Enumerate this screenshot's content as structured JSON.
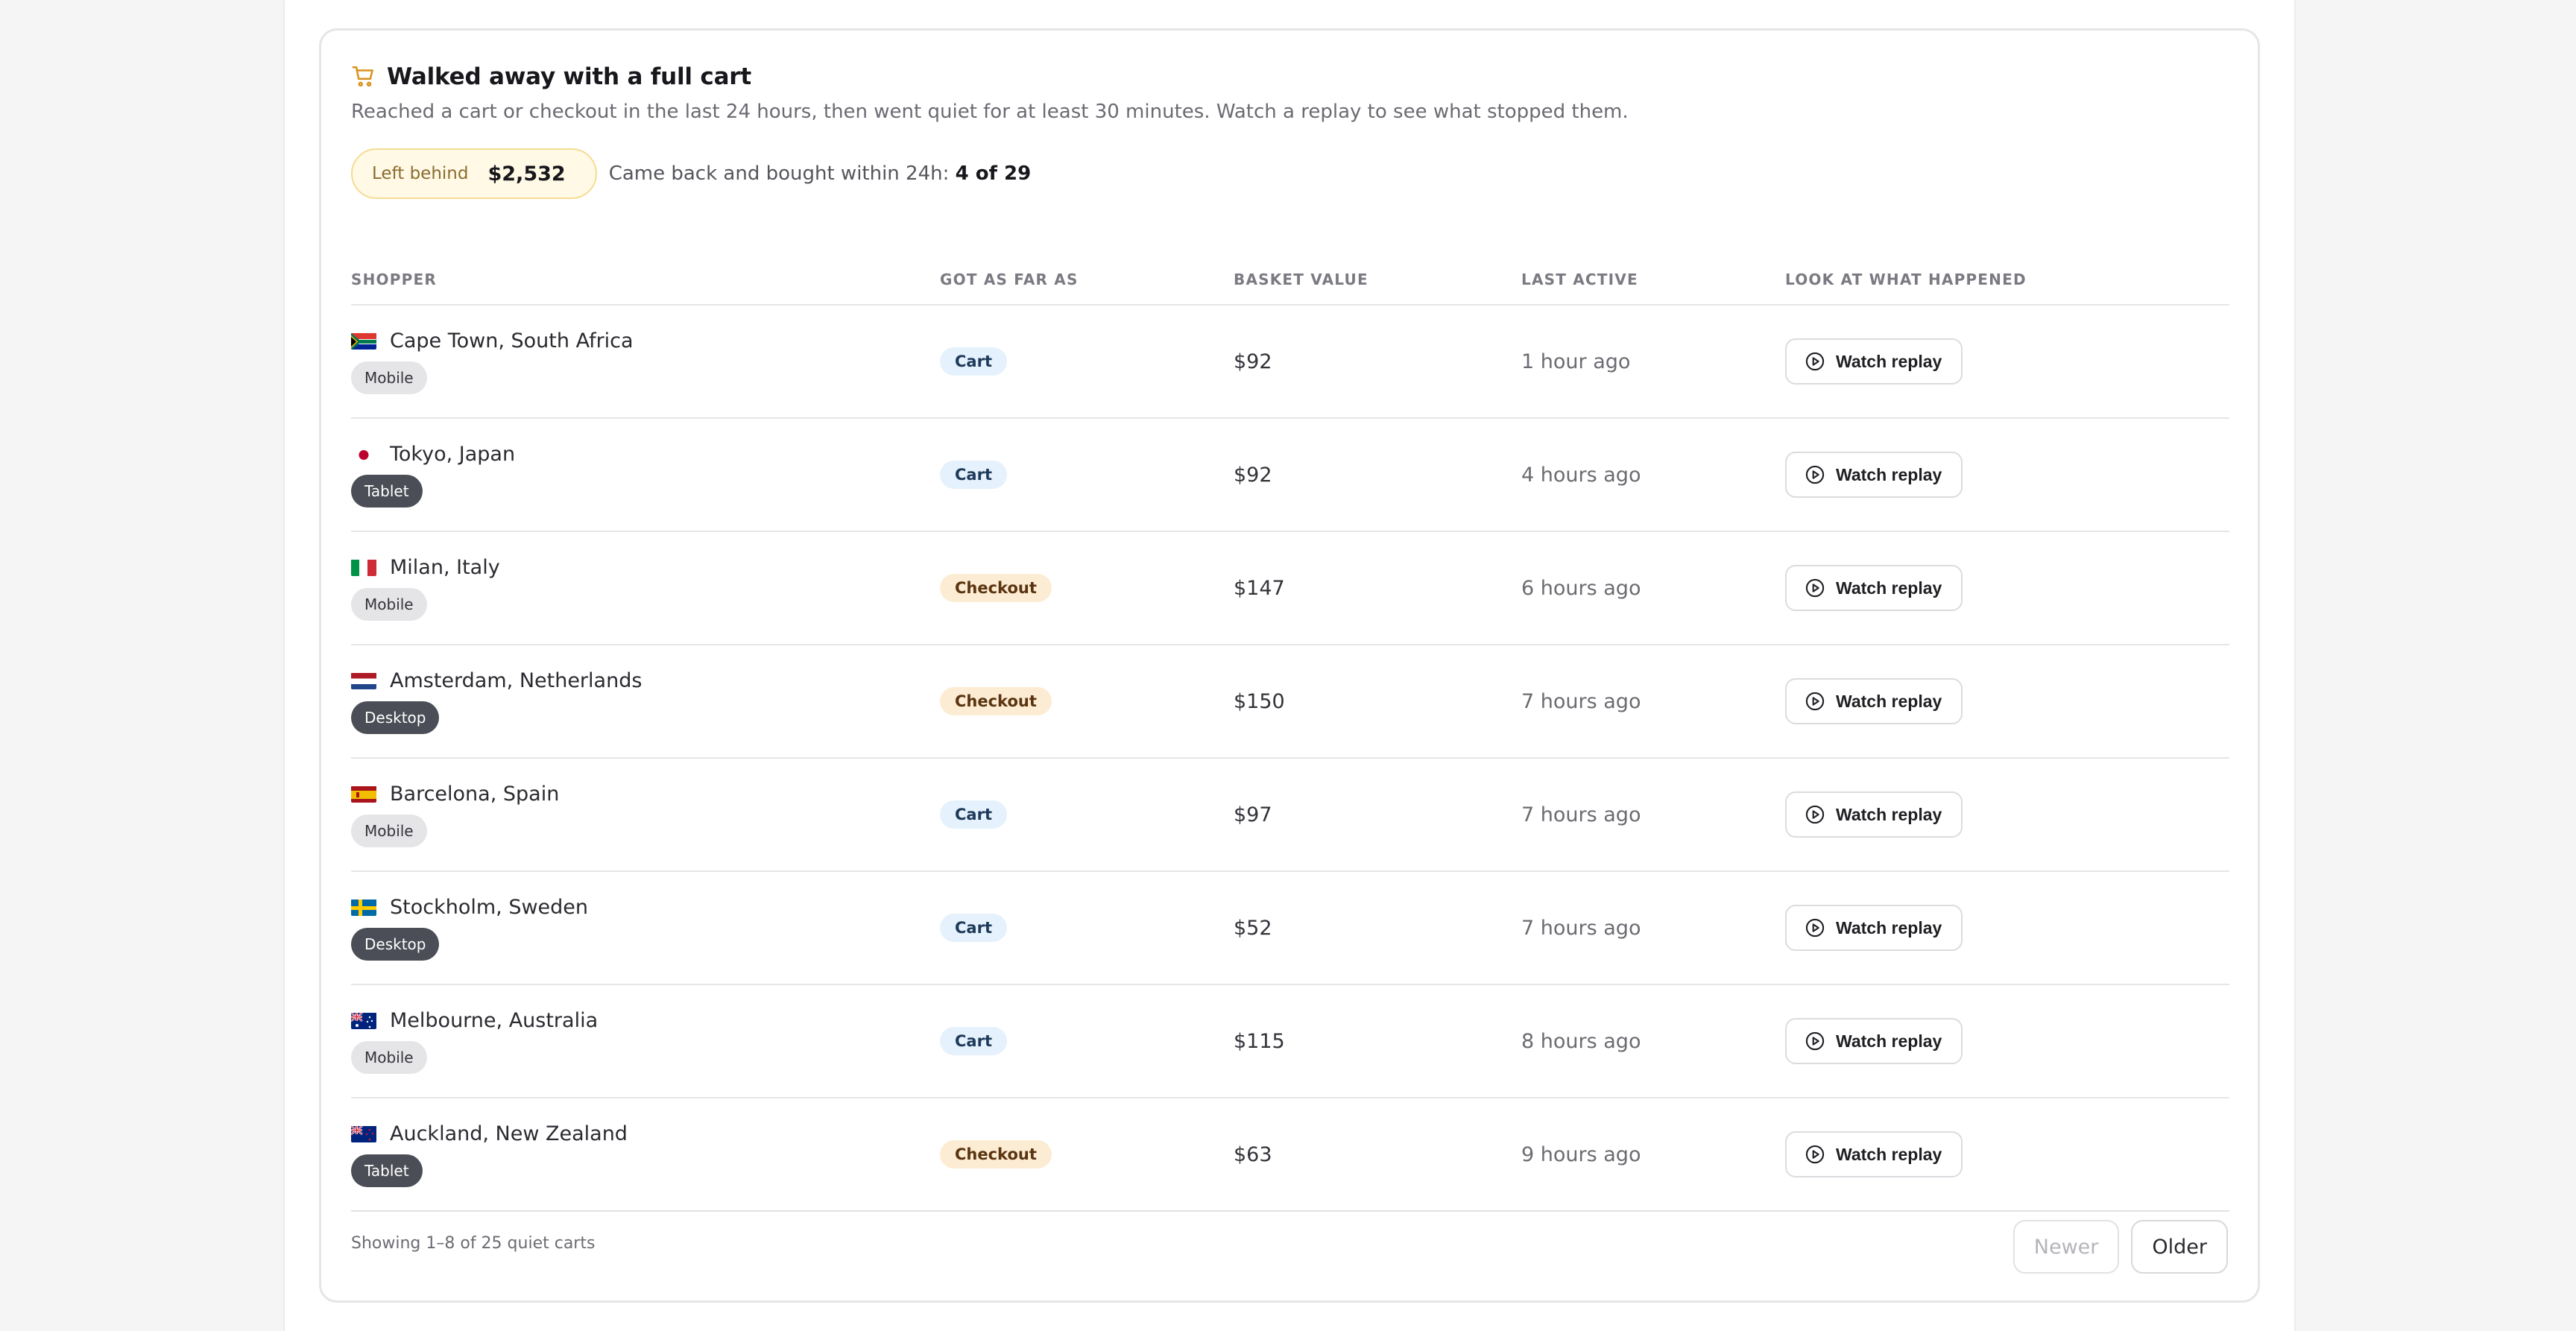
{
  "panel": {
    "title": "Walked away with a full cart",
    "icon": "shopping-cart-icon",
    "subtitle": "Reached a cart or checkout in the last 24 hours, then went quiet for at least 30 minutes. Watch a replay to see what stopped them.",
    "left_behind_label": "Left behind",
    "left_behind_amount": "$2,532",
    "returned_label": "Came back and bought within 24h:",
    "returned_value": "4 of 29"
  },
  "table": {
    "headers": [
      "SHOPPER",
      "GOT AS FAR AS",
      "BASKET VALUE",
      "LAST ACTIVE",
      "LOOK AT WHAT HAPPENED"
    ],
    "rows": [
      {
        "location": "Cape Town, South Africa",
        "flag": "south-africa",
        "device": "Mobile",
        "stage": "Cart",
        "value": "$92",
        "last_active": "1 hour ago",
        "action": "Watch replay"
      },
      {
        "location": "Tokyo, Japan",
        "flag": "japan",
        "device": "Tablet",
        "stage": "Cart",
        "value": "$92",
        "last_active": "4 hours ago",
        "action": "Watch replay"
      },
      {
        "location": "Milan, Italy",
        "flag": "italy",
        "device": "Mobile",
        "stage": "Checkout",
        "value": "$147",
        "last_active": "6 hours ago",
        "action": "Watch replay"
      },
      {
        "location": "Amsterdam, Netherlands",
        "flag": "netherlands",
        "device": "Desktop",
        "stage": "Checkout",
        "value": "$150",
        "last_active": "7 hours ago",
        "action": "Watch replay"
      },
      {
        "location": "Barcelona, Spain",
        "flag": "spain",
        "device": "Mobile",
        "stage": "Cart",
        "value": "$97",
        "last_active": "7 hours ago",
        "action": "Watch replay"
      },
      {
        "location": "Stockholm, Sweden",
        "flag": "sweden",
        "device": "Desktop",
        "stage": "Cart",
        "value": "$52",
        "last_active": "7 hours ago",
        "action": "Watch replay"
      },
      {
        "location": "Melbourne, Australia",
        "flag": "australia",
        "device": "Mobile",
        "stage": "Cart",
        "value": "$115",
        "last_active": "8 hours ago",
        "action": "Watch replay"
      },
      {
        "location": "Auckland, New Zealand",
        "flag": "new-zealand",
        "device": "Tablet",
        "stage": "Checkout",
        "value": "$63",
        "last_active": "9 hours ago",
        "action": "Watch replay"
      }
    ]
  },
  "footer": {
    "showing": "Showing 1–8 of 25 quiet carts",
    "newer_label": "Newer",
    "older_label": "Older"
  },
  "colors": {
    "accent_pill_bg": "#fff9e6",
    "accent_pill_border": "#f5dc93",
    "cart_badge_bg": "#e5f1fc",
    "checkout_badge_bg": "#fdecd4",
    "device_dark_bg": "#4b4e56",
    "device_light_bg": "#e5e5e8"
  }
}
